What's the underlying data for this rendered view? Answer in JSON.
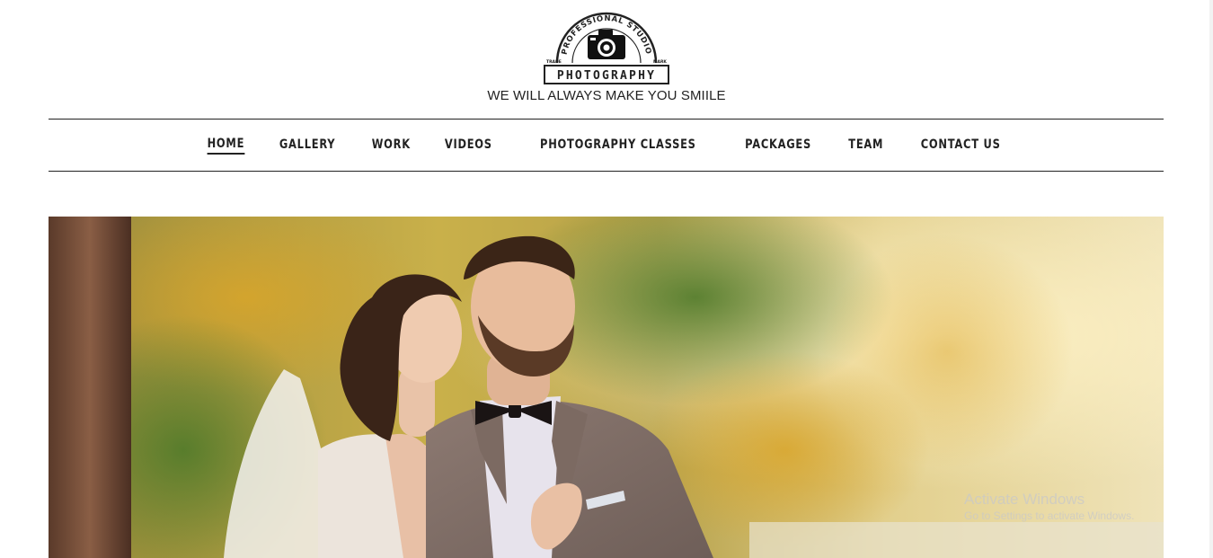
{
  "brand": {
    "logo_arc_text": "PROFESSIONAL STUDIO",
    "logo_word": "PHOTOGRAPHY",
    "logo_left_tag": "TRADE",
    "logo_right_tag": "MARK",
    "tagline": "WE WILL ALWAYS MAKE YOU SMIILE",
    "logo_icon": "camera-icon"
  },
  "nav": {
    "items": [
      {
        "label": "HOME",
        "active": true
      },
      {
        "label": "GALLERY",
        "active": false
      },
      {
        "label": "WORK",
        "active": false
      },
      {
        "label": "VIDEOS",
        "active": false
      },
      {
        "label": "PHOTOGRAPHY CLASSES",
        "active": false
      },
      {
        "label": "PACKAGES",
        "active": false
      },
      {
        "label": "TEAM",
        "active": false
      },
      {
        "label": "CONTACT US",
        "active": false
      }
    ]
  },
  "hero": {
    "subject": "wedding-couple-photo"
  },
  "os_watermark": {
    "title": "Activate Windows",
    "subtitle": "Go to Settings to activate Windows."
  },
  "colors": {
    "text": "#222222",
    "rule": "#222222",
    "background": "#ffffff"
  }
}
